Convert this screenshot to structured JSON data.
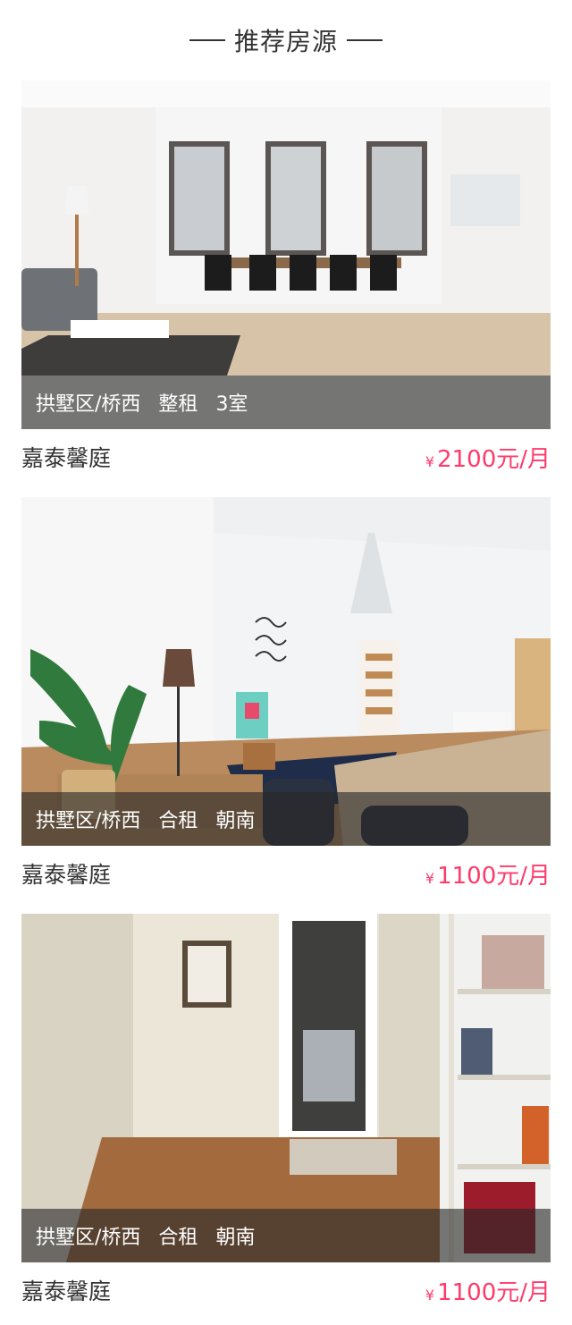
{
  "header": {
    "title": "推荐房源"
  },
  "listings": [
    {
      "tags": [
        "拱墅区/桥西",
        "整租",
        "3室"
      ],
      "name": "嘉泰馨庭",
      "currency": "¥",
      "price": "2100元/月"
    },
    {
      "tags": [
        "拱墅区/桥西",
        "合租",
        "朝南"
      ],
      "name": "嘉泰馨庭",
      "currency": "¥",
      "price": "1100元/月"
    },
    {
      "tags": [
        "拱墅区/桥西",
        "合租",
        "朝南"
      ],
      "name": "嘉泰馨庭",
      "currency": "¥",
      "price": "1100元/月"
    }
  ],
  "colors": {
    "accent": "#ff3b6b",
    "overlay": "rgba(40,40,40,0.62)"
  }
}
